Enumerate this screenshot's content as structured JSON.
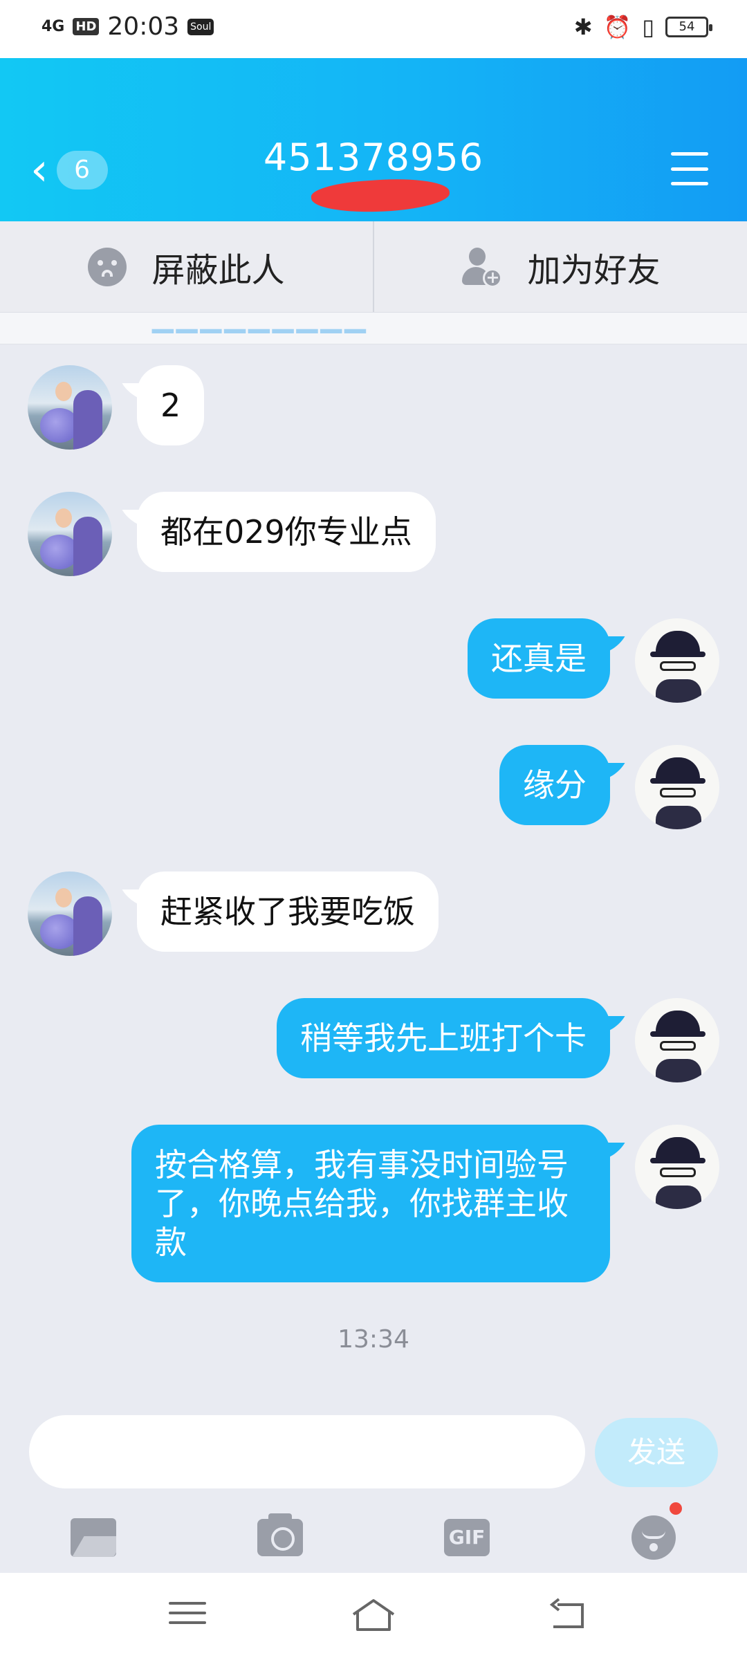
{
  "status_bar": {
    "network": "4G",
    "hd": "HD",
    "time": "20:03",
    "app_badge": "Soul",
    "battery": "54"
  },
  "header": {
    "back_count": "6",
    "title": "451378956",
    "subtitle": "来自…群",
    "colors": {
      "gradient_start": "#12c8f4",
      "gradient_end": "#139cf4"
    }
  },
  "actions": [
    {
      "label": "屏蔽此人",
      "icon": "block-face-icon"
    },
    {
      "label": "加为好友",
      "icon": "add-friend-icon"
    }
  ],
  "messages": [
    {
      "side": "in",
      "text": "2"
    },
    {
      "side": "in",
      "text": "都在029你专业点"
    },
    {
      "side": "out",
      "text": "还真是"
    },
    {
      "side": "out",
      "text": "缘分"
    },
    {
      "side": "in",
      "text": "赶紧收了我要吃饭"
    },
    {
      "side": "out",
      "text": "稍等我先上班打个卡"
    },
    {
      "side": "out",
      "text": "按合格算，我有事没时间验号了，你晚点给我，你找群主收款"
    }
  ],
  "timestamp": "13:34",
  "input": {
    "value": "",
    "placeholder": "",
    "send_label": "发送"
  },
  "toolbar": [
    "image-icon",
    "camera-icon",
    "gif-icon",
    "emoji-icon"
  ],
  "toolbar_gif_label": "GIF",
  "colors": {
    "out_bubble": "#1eb6f6",
    "in_bubble": "#ffffff",
    "background": "#e9ebf2"
  }
}
